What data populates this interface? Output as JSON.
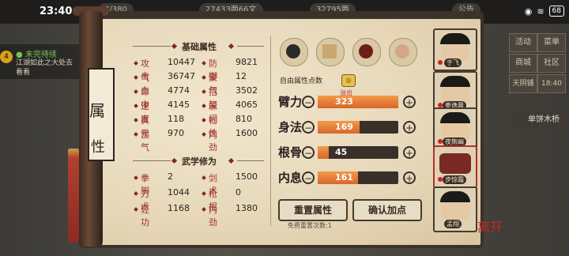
{
  "status_bar": {
    "time_left": "23:40",
    "battery": "68"
  },
  "top_bar": {
    "pill_1": "7/380",
    "pill_2": "27433两66文",
    "pill_3": "32795两",
    "pill_4": "公告"
  },
  "quest": {
    "badge": "4",
    "title": "● 未完待续",
    "desc": "江湖如此之大处去看看"
  },
  "side_buttons": [
    "活动",
    "菜单",
    "商城",
    "社区",
    "天阴铺",
    "18:40"
  ],
  "bridge_label": "单饼木桥",
  "scroll": {
    "title_chars": [
      "属",
      "性"
    ]
  },
  "basic_attrs": {
    "header": "基础属性",
    "left": [
      {
        "label": "攻击",
        "value": "10447"
      },
      {
        "label": "气血",
        "value": "36747"
      },
      {
        "label": "命中",
        "value": "4774"
      },
      {
        "label": "速度",
        "value": "4145"
      },
      {
        "label": "真元",
        "value": "118"
      },
      {
        "label": "罡气",
        "value": "970"
      }
    ],
    "right": [
      {
        "label": "防御",
        "value": "9821"
      },
      {
        "label": "聚气",
        "value": "12"
      },
      {
        "label": "招架",
        "value": "3502"
      },
      {
        "label": "躲闪",
        "value": "4065"
      },
      {
        "label": "韧性",
        "value": "810"
      },
      {
        "label": "内劲",
        "value": "1600"
      }
    ]
  },
  "martial": {
    "header": "武学修为",
    "left": [
      {
        "label": "拳脚",
        "value": "2"
      },
      {
        "label": "刀术",
        "value": "1044"
      },
      {
        "label": "轻功",
        "value": "1168"
      }
    ],
    "right": [
      {
        "label": "剑术",
        "value": "1500"
      },
      {
        "label": "枪棍",
        "value": "0"
      },
      {
        "label": "内劲",
        "value": "1380"
      }
    ]
  },
  "free_points": {
    "label": "自由属性点数",
    "badge": "◎"
  },
  "point_bars": [
    {
      "name": "臂力",
      "value": "323",
      "fill": 1.0,
      "overflow_label": "溢出"
    },
    {
      "name": "身法",
      "value": "169",
      "fill": 0.52
    },
    {
      "name": "根骨",
      "value": "45",
      "fill": 0.14
    },
    {
      "name": "内息",
      "value": "161",
      "fill": 0.5
    }
  ],
  "buttons": {
    "reset": "重置属性",
    "confirm": "确认加点"
  },
  "reset_note": "免费重置次数:1",
  "characters": [
    {
      "name": "于飞"
    },
    {
      "name": "姜逸晨"
    },
    {
      "name": "夜無幽"
    },
    {
      "name": "步惊霜"
    },
    {
      "name": "孟翔"
    }
  ],
  "seal_text": "离开",
  "colors": {
    "accent": "#a0342a",
    "bar": "#e07a35",
    "paper": "#e9dcc0"
  }
}
